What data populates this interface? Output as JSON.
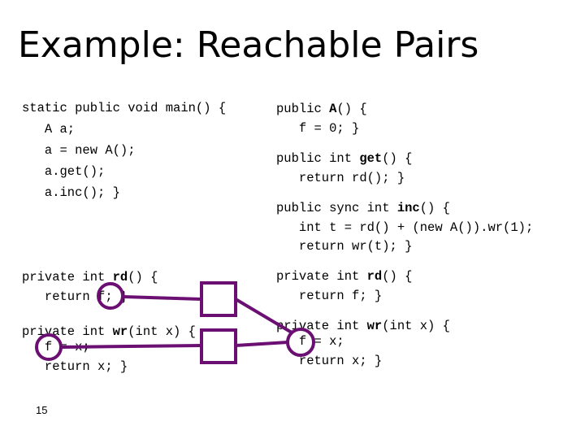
{
  "slide": {
    "title": "Example: Reachable Pairs",
    "page_number": "15",
    "accent_color": "#6b0f73"
  },
  "left_code": {
    "main": [
      "static public void main() {",
      "   A a;",
      "   a = new A();",
      "   a.get();",
      "   a.inc(); }"
    ],
    "rd": {
      "sig_pre": "private int ",
      "sig_name": "rd",
      "sig_post": "() {",
      "body": "   return f; }"
    },
    "wr": {
      "sig_pre": "private int ",
      "sig_name": "wr",
      "sig_post": "(int x) {",
      "body1": "   f = x;",
      "body2": "   return x; }"
    }
  },
  "right_code": {
    "ctor": {
      "pre": "public ",
      "name": "A",
      "post": "() {",
      "body": "   f = 0; }"
    },
    "get": {
      "pre": "public int ",
      "name": "get",
      "post": "() {",
      "body": "   return rd(); }"
    },
    "inc": {
      "pre": "public sync int ",
      "name": "inc",
      "post": "() {",
      "body1": "   int t = rd() + (new A()).wr(1);",
      "body2": "   return wr(t); }"
    },
    "rd": {
      "pre": "private int ",
      "name": "rd",
      "post": "() {",
      "body": "   return f; }"
    },
    "wr": {
      "pre": "private int ",
      "name": "wr",
      "post": "(int x) {",
      "body1": "   f = x;",
      "body2": "   return x; }"
    }
  },
  "diagram": {
    "nodes": [
      {
        "id": "left-rd-f",
        "label": "f read in rd (left)"
      },
      {
        "id": "left-wr-f",
        "label": "f written in wr (left)"
      },
      {
        "id": "right-wr-f",
        "label": "f written in wr (right)"
      },
      {
        "id": "box-top",
        "label": ""
      },
      {
        "id": "box-bottom",
        "label": ""
      }
    ],
    "edges": [
      [
        "left-rd-f",
        "box-top"
      ],
      [
        "box-top",
        "right-wr-f"
      ],
      [
        "left-wr-f",
        "box-bottom"
      ],
      [
        "box-bottom",
        "right-wr-f"
      ]
    ]
  }
}
